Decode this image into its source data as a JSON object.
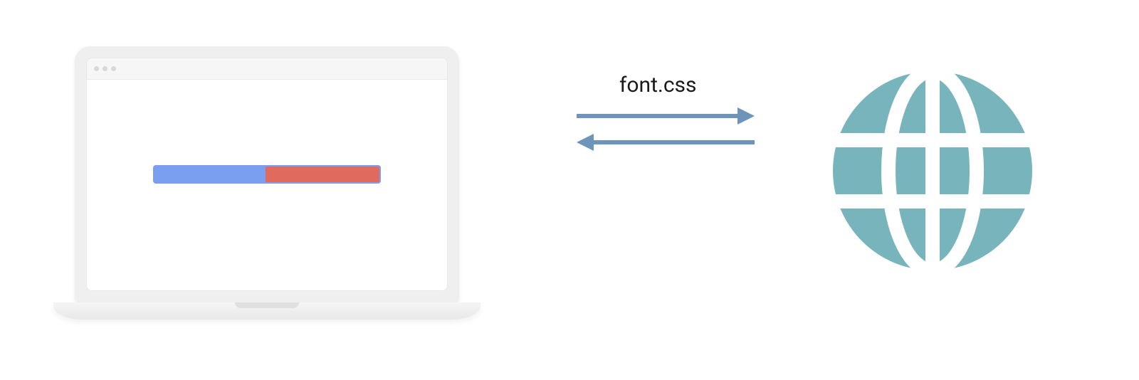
{
  "diagram": {
    "request_label": "font.css",
    "colors": {
      "arrow": "#6d94b9",
      "globe": "#77b4bb",
      "progress_blue": "#7a9ff0",
      "progress_red": "#e06a5e",
      "laptop_bezel": "#efefef"
    },
    "elements": {
      "laptop": "laptop-with-browser",
      "browser_dots": 3,
      "arrow_right": "request-arrow",
      "arrow_left": "response-arrow",
      "globe": "web-server-globe"
    }
  }
}
